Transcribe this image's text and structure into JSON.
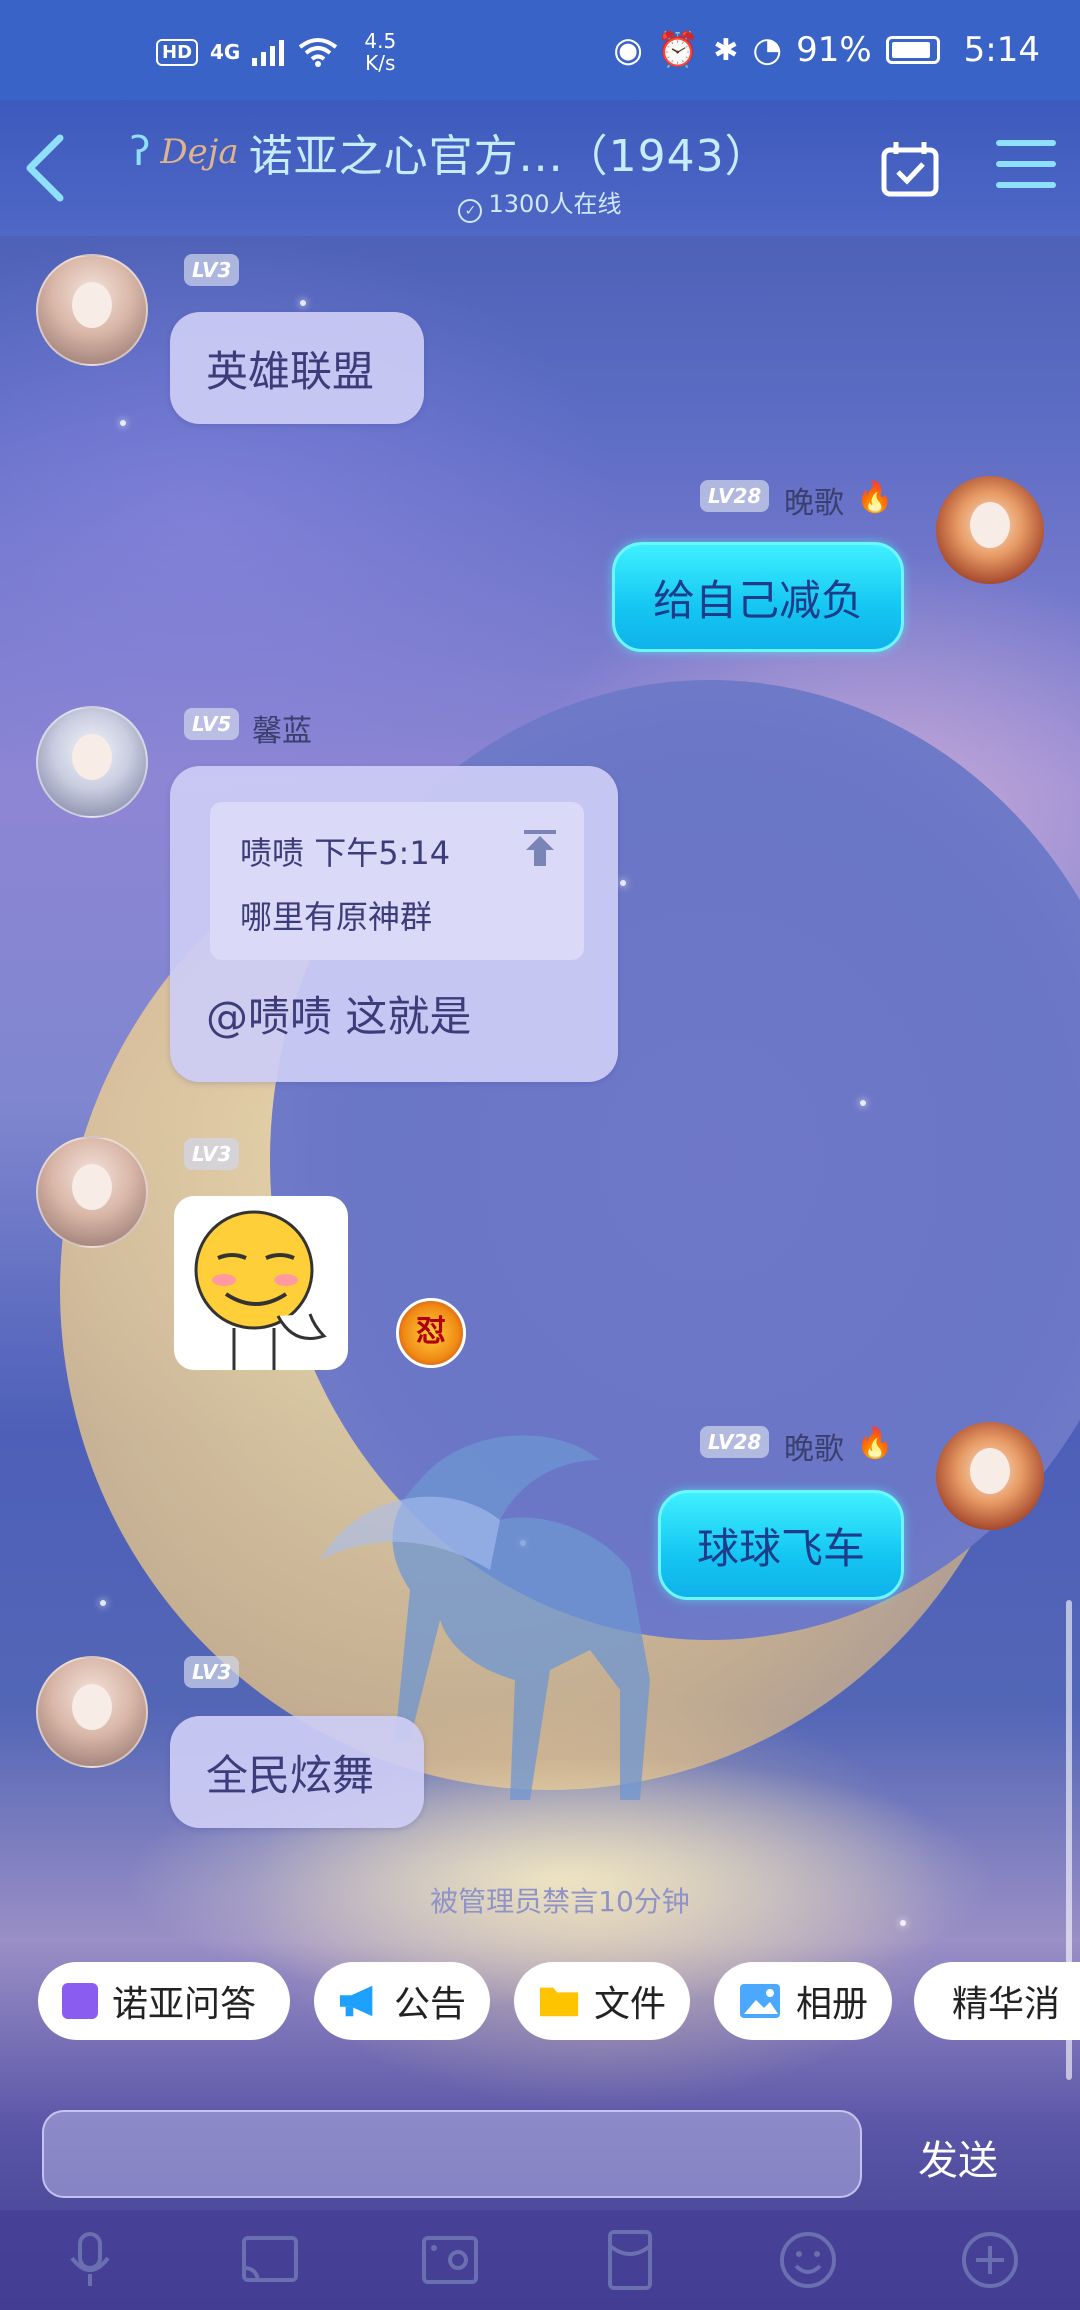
{
  "status_bar": {
    "hd": "HD",
    "network": "4G",
    "speed_value": "4.5",
    "speed_unit": "K/s",
    "battery": "91%",
    "time": "5:14"
  },
  "header": {
    "deja_logo": "Deja",
    "title": "诺亚之心官方...（1943）",
    "online": "1300人在线"
  },
  "messages": [
    {
      "level": "LV3",
      "nickname": "",
      "text": "英雄联盟",
      "side": "left"
    },
    {
      "level": "LV28",
      "nickname": "晚歌",
      "text": "给自己减负",
      "side": "right"
    },
    {
      "level": "LV5",
      "nickname": "馨蓝",
      "side": "left",
      "reply": {
        "author": "啧啧",
        "time": "下午5:14",
        "quoted": "哪里有原神群"
      },
      "text": "@啧啧 这就是"
    },
    {
      "level": "LV3",
      "nickname": "",
      "type": "sticker",
      "side": "left",
      "reaction": "怼"
    },
    {
      "level": "LV28",
      "nickname": "晚歌",
      "text": "球球飞车",
      "side": "right"
    },
    {
      "level": "LV3",
      "nickname": "",
      "text": "全民炫舞",
      "side": "left"
    }
  ],
  "system_note": "被管理员禁言10分钟",
  "chips": [
    {
      "label": "诺亚问答",
      "icon": "qa-icon",
      "color": "#8a5cf0"
    },
    {
      "label": "公告",
      "icon": "megaphone-icon",
      "color": "#1ea0ff"
    },
    {
      "label": "文件",
      "icon": "folder-icon",
      "color": "#ffc400"
    },
    {
      "label": "相册",
      "icon": "album-icon",
      "color": "#4aa8ff"
    },
    {
      "label": "精华消",
      "icon": "essence-icon",
      "color": "#ffc400"
    }
  ],
  "input": {
    "placeholder": "",
    "send_label": "发送"
  },
  "toolbar": [
    "mic-icon",
    "cast-icon",
    "photo-icon",
    "redpacket-icon",
    "emoji-icon",
    "plus-icon"
  ]
}
